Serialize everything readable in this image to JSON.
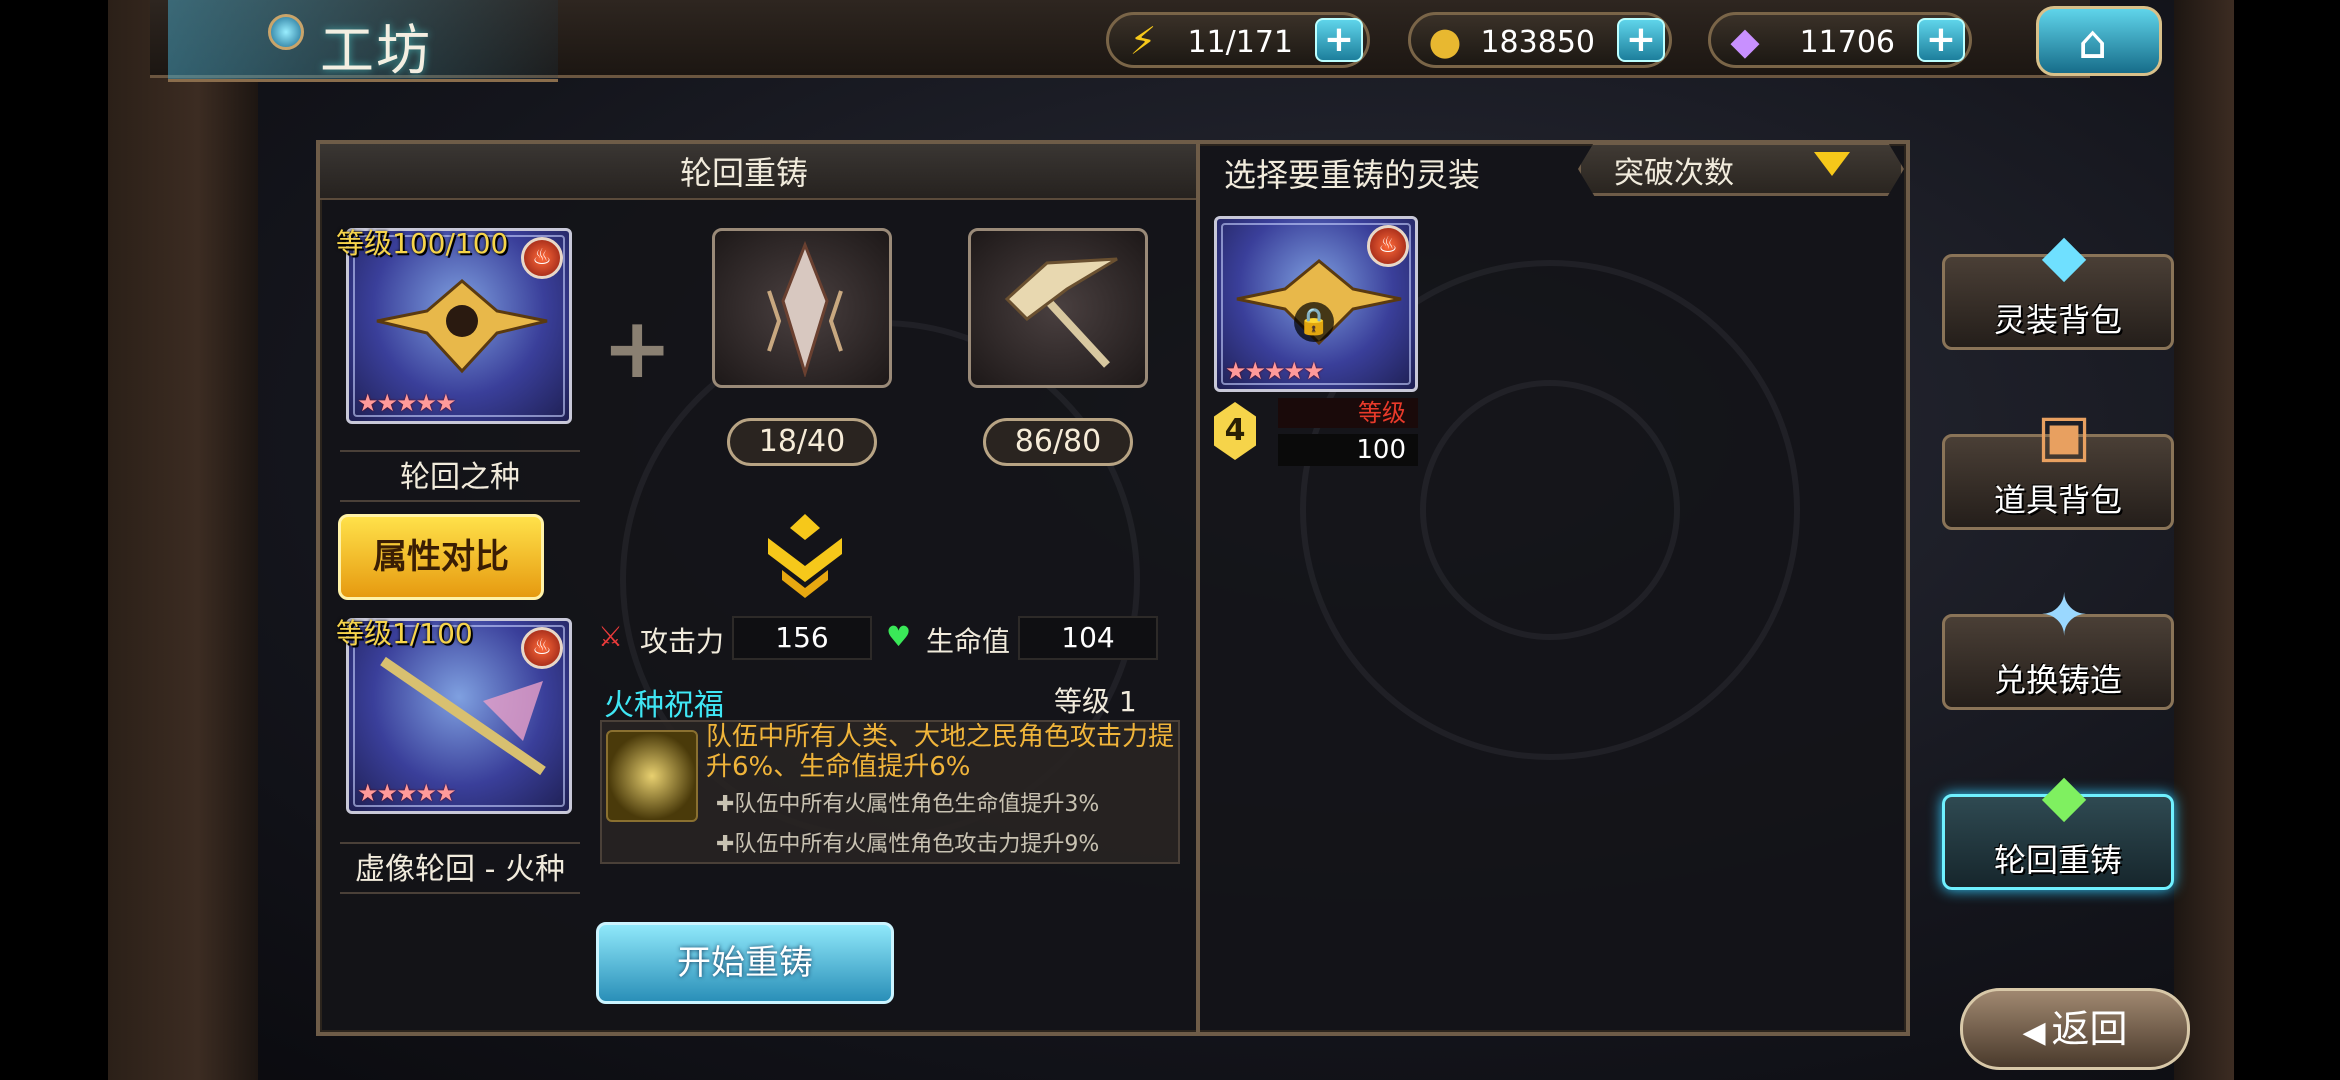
{
  "header": {
    "title": "工坊",
    "resources": [
      {
        "name": "stamina",
        "icon": "lightning-icon",
        "value": "11/171"
      },
      {
        "name": "gold",
        "icon": "coin-icon",
        "value": "183850"
      },
      {
        "name": "crystal",
        "icon": "crystal-icon",
        "value": "11706"
      }
    ]
  },
  "left_panel": {
    "title": "轮回重铸",
    "main_item": {
      "level": "等级100/100",
      "name": "轮回之种",
      "stars": "★★★★★"
    },
    "compare_button": "属性对比",
    "materials": [
      {
        "count": "18/40"
      },
      {
        "count": "86/80"
      }
    ],
    "result_item": {
      "level": "等级1/100",
      "name": "虚像轮回 - 火种",
      "stars": "★★★★★"
    },
    "stats": {
      "attack_label": "攻击力",
      "attack_value": "156",
      "hp_label": "生命值",
      "hp_value": "104"
    },
    "skill": {
      "name": "火种祝福",
      "level": "等级 1",
      "desc": "队伍中所有人类、大地之民角色攻击力提升6%、生命值提升6%",
      "sub1": "✚队伍中所有火属性角色生命值提升3%",
      "sub2": "✚队伍中所有火属性角色攻击力提升9%"
    },
    "start_button": "开始重铸"
  },
  "right_panel": {
    "title": "选择要重铸的灵装",
    "sort_label": "突破次数",
    "item": {
      "stars": "★★★★★",
      "badge": "4",
      "level_label": "等级",
      "level_value": "100"
    }
  },
  "side_nav": [
    {
      "label": "灵装背包",
      "icon": "chest-crystal-icon"
    },
    {
      "label": "道具背包",
      "icon": "chest-potion-icon"
    },
    {
      "label": "兑换铸造",
      "icon": "crystal-anvil-icon"
    },
    {
      "label": "轮回重铸",
      "icon": "green-gem-icon"
    }
  ],
  "back_button": "返回",
  "colors": {
    "accent_cyan": "#3fe6f4",
    "gold": "#f6d44a",
    "skill_text": "#f0b43a"
  }
}
